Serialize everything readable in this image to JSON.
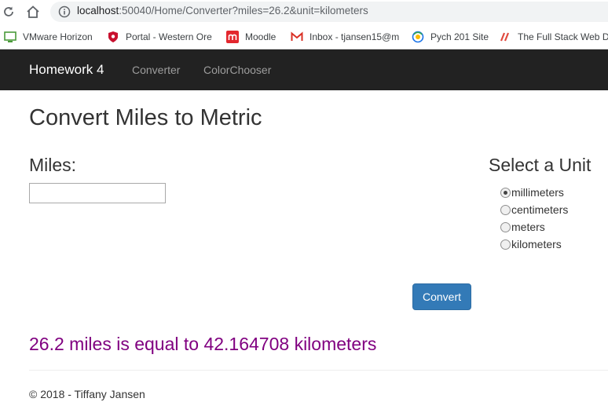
{
  "browser": {
    "url_host": "localhost",
    "url_rest": ":50040/Home/Converter?miles=26.2&unit=kilometers",
    "bookmarks": [
      {
        "label": "VMware Horizon",
        "icon": "vmware-icon"
      },
      {
        "label": "Portal - Western Ore",
        "icon": "wou-icon"
      },
      {
        "label": "Moodle",
        "icon": "moodle-icon"
      },
      {
        "label": "Inbox - tjansen15@m",
        "icon": "gmail-icon"
      },
      {
        "label": "Pych 201 Site",
        "icon": "site-icon"
      },
      {
        "label": "The Full Stack Web D",
        "icon": "fullstack-icon"
      }
    ]
  },
  "navbar": {
    "brand": "Homework 4",
    "links": [
      "Converter",
      "ColorChooser"
    ]
  },
  "main": {
    "title": "Convert Miles to Metric",
    "miles_label": "Miles:",
    "miles_value": "",
    "unit_heading": "Select a Unit",
    "units": [
      {
        "label": "millimeters",
        "checked": true
      },
      {
        "label": "centimeters",
        "checked": false
      },
      {
        "label": "meters",
        "checked": false
      },
      {
        "label": "kilometers",
        "checked": false
      }
    ],
    "convert_label": "Convert",
    "result": "26.2 miles is equal to 42.164708 kilometers"
  },
  "footer": {
    "text": "© 2018 - Tiffany Jansen"
  },
  "colors": {
    "navbar_bg": "#222222",
    "button_primary": "#337ab7",
    "result_text": "#800080"
  }
}
